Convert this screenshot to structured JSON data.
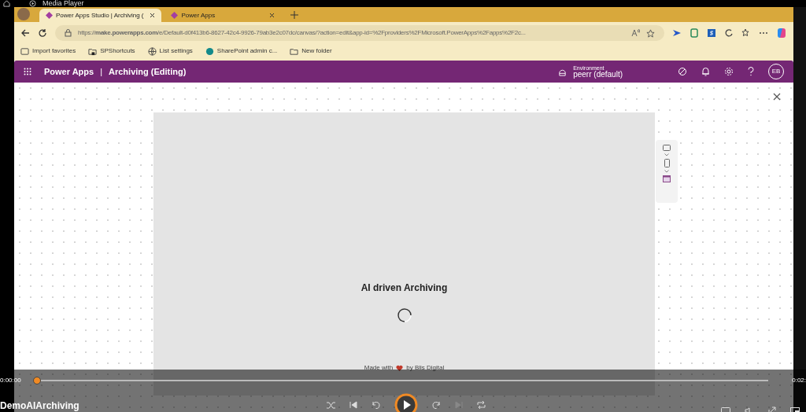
{
  "media_player": {
    "title": "Media Player",
    "time_elapsed": "0:00:00",
    "time_total": "0:02:",
    "seek": {
      "level": 0
    },
    "video_title": "DemoAIArchiving"
  },
  "browser": {
    "tabs": [
      {
        "label": "Power Apps Studio | Archiving (",
        "selected": true
      },
      {
        "label": "Power Apps",
        "selected": false
      }
    ],
    "url": "https://**make.powerapps.com**/e/Default-d0f413b6-8627-42c4-9926-79ab3e2c07dc/canvas/?action=edit&app-id=%2Fproviders%2FMicrosoft.PowerApps%2Fapps%2F2c...",
    "bookmarks": [
      {
        "kind": "favorites",
        "label": "Import favorites"
      },
      {
        "kind": "folder-shortcut",
        "label": "SPShortcuts"
      },
      {
        "kind": "globe",
        "label": "List settings"
      },
      {
        "kind": "sharepoint",
        "label": "SharePoint admin c..."
      },
      {
        "kind": "folder",
        "label": "New folder"
      }
    ]
  },
  "app_header": {
    "product": "Power Apps",
    "separator": "|",
    "app_name": "Archiving (Editing)",
    "environment_label": "Environment",
    "environment_name": "peerr (default)",
    "avatar": "EB"
  },
  "preview": {
    "title": "AI driven Archiving",
    "footer_before": "Made with",
    "footer_after": "by Blis Digital"
  }
}
